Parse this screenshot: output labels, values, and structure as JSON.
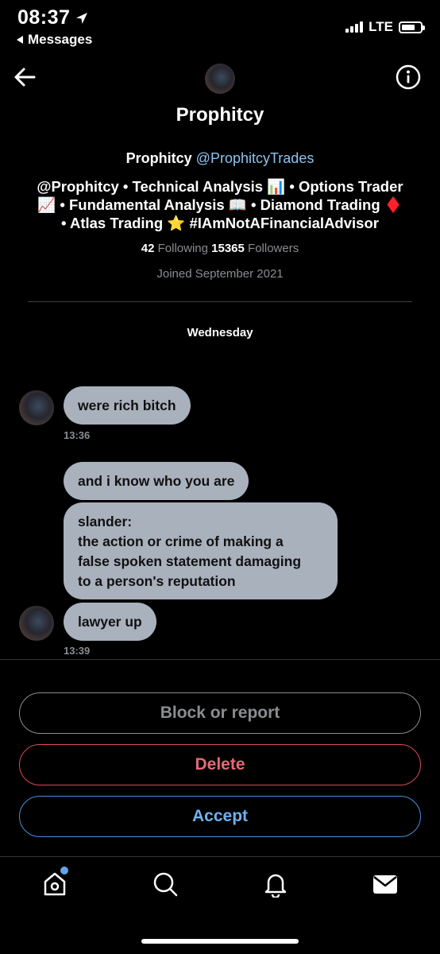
{
  "status_bar": {
    "time": "08:37",
    "back_label": "Messages",
    "network": "LTE"
  },
  "header": {
    "title": "Prophitcy"
  },
  "profile": {
    "name": "Prophitcy",
    "handle": "@ProphitcyTrades",
    "bio_line1": "@Prophitcy • Technical Analysis 📊 • Options Trader",
    "bio_line2": "📈 • Fundamental Analysis 📖 • Diamond Trading ♦️",
    "bio_line3": "• Atlas Trading ⭐ #IAmNotAFinancialAdvisor",
    "following_count": "42",
    "following_label": "Following",
    "followers_count": "15365",
    "followers_label": "Followers",
    "joined": "Joined September 2021"
  },
  "conversation": {
    "day_label": "Wednesday",
    "messages": [
      {
        "text": "were rich bitch",
        "time": "13:36"
      },
      {
        "text": "and i know who you are"
      },
      {
        "line1": "slander:",
        "line2": "the action or crime of making a",
        "line3": "false spoken statement damaging",
        "line4": "to a person's reputation"
      },
      {
        "text": "lawyer up",
        "time": "13:39"
      }
    ]
  },
  "actions": {
    "block_label": "Block or report",
    "delete_label": "Delete",
    "accept_label": "Accept"
  },
  "tab_bar": {
    "icons": [
      "home-icon",
      "search-icon",
      "notifications-icon",
      "messages-icon"
    ],
    "notification_dot_color": "#5fa6e8"
  },
  "colors": {
    "bubble": "#a9b1bd",
    "accent": "#8ec3ef",
    "delete": "#e36a74",
    "accept": "#6fb1ee"
  }
}
